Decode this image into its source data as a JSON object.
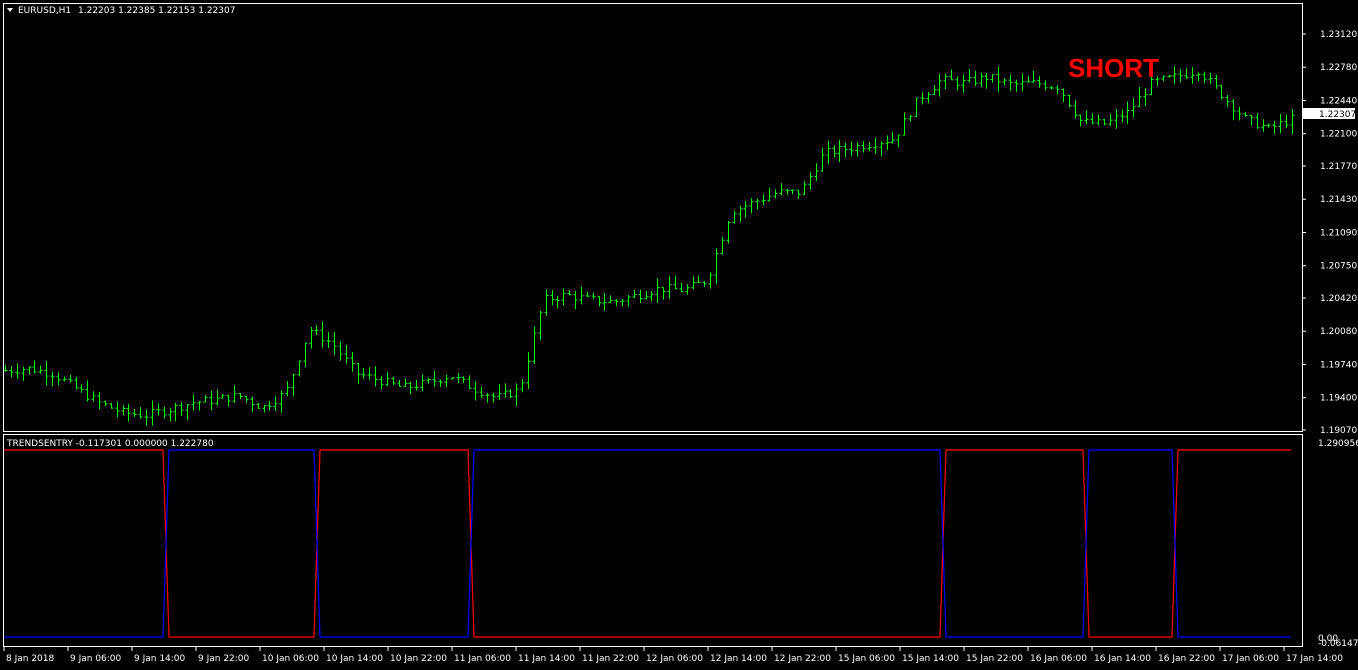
{
  "main_panel": {
    "symbol_label": "EURUSD,H1",
    "ohlc_label": "1.22203 1.22385 1.22153 1.22307",
    "current_price_label": "1.22307",
    "annotation": "SHORT",
    "colors": {
      "background": "#000000",
      "bars": "#00ff00",
      "frame": "#ffffff",
      "annotation": "#ff0000"
    }
  },
  "indicator_panel": {
    "label": "TRENDSENTRY -0.117301 0.000000 1.222780",
    "top_value_label": "1.290956",
    "bottom_value_label": "-0.061474",
    "zero_label": "0.00",
    "colors": {
      "up": "#0000ff",
      "down": "#ff0000"
    }
  },
  "chart_data": [
    {
      "type": "ohlc",
      "series": [
        {
          "name": "EURUSD,H1"
        }
      ],
      "ylim": [
        1.1907,
        1.2312
      ],
      "y_ticks": [
        "1.23120",
        "1.22780",
        "1.22440",
        "1.22100",
        "1.21770",
        "1.21430",
        "1.21090",
        "1.20750",
        "1.20420",
        "1.20080",
        "1.19740",
        "1.19400",
        "1.19070"
      ],
      "x_ticks": [
        "8 Jan 2018",
        "9 Jan 06:00",
        "9 Jan 14:00",
        "9 Jan 22:00",
        "10 Jan 06:00",
        "10 Jan 14:00",
        "10 Jan 22:00",
        "11 Jan 06:00",
        "11 Jan 14:00",
        "11 Jan 22:00",
        "12 Jan 06:00",
        "12 Jan 14:00",
        "12 Jan 22:00",
        "15 Jan 06:00",
        "15 Jan 14:00",
        "15 Jan 22:00",
        "16 Jan 06:00",
        "16 Jan 14:00",
        "16 Jan 22:00",
        "17 Jan 06:00",
        "17 Jan 14:00"
      ],
      "close_path": [
        1.1968,
        1.197,
        1.1965,
        1.195,
        1.1935,
        1.1925,
        1.1922,
        1.1928,
        1.1935,
        1.1938,
        1.1942,
        1.193,
        1.1945,
        1.201,
        1.1995,
        1.1965,
        1.1958,
        1.195,
        1.1955,
        1.1963,
        1.195,
        1.194,
        1.1948,
        1.204,
        1.2045,
        1.204,
        1.2038,
        1.2045,
        1.2052,
        1.205,
        1.206,
        1.213,
        1.214,
        1.215,
        1.215,
        1.219,
        1.2195,
        1.22,
        1.2205,
        1.2245,
        1.2265,
        1.2262,
        1.2268,
        1.226,
        1.2262,
        1.2258,
        1.2222,
        1.222,
        1.2232,
        1.2262,
        1.2268,
        1.2275,
        1.225,
        1.2225,
        1.2215,
        1.2225
      ],
      "last_close": 1.22307
    },
    {
      "type": "line",
      "ylim": [
        -0.061474,
        1.290956
      ],
      "series": [
        {
          "segments": [
            [
              0,
              0.163,
              "down"
            ],
            [
              0.163,
              0.314,
              "up"
            ],
            [
              0.314,
              0.468,
              "down"
            ],
            [
              0.468,
              0.94,
              "up"
            ],
            [
              0.94,
              1.083,
              "down"
            ],
            [
              1.083,
              1.172,
              "up"
            ],
            [
              1.172,
              1.0,
              "down"
            ]
          ]
        }
      ],
      "high_level": 1.22278,
      "low_level": 0.0
    }
  ]
}
